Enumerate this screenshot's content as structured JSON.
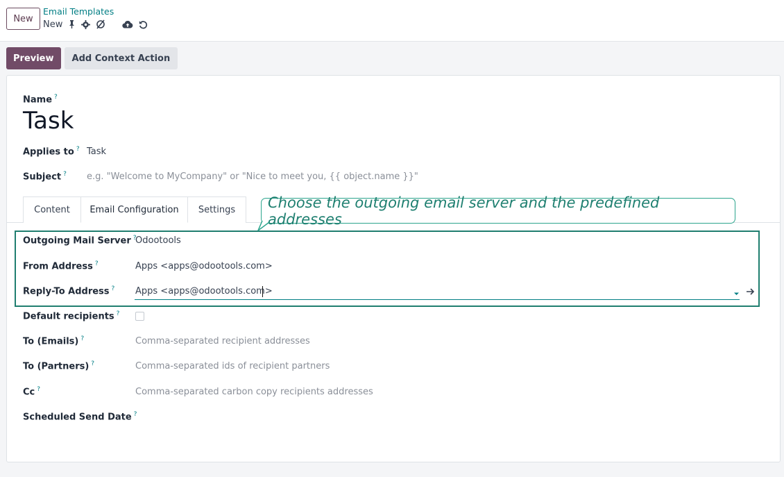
{
  "topbar": {
    "new_label": "New",
    "breadcrumb": "Email Templates",
    "record_label": "New",
    "icons": [
      "pin-icon",
      "gear-icon",
      "refresh-icon",
      "cloud-upload-icon",
      "undo-icon"
    ]
  },
  "actions": {
    "preview": "Preview",
    "add_context": "Add Context Action"
  },
  "form": {
    "name_label": "Name",
    "name_value": "Task",
    "applies_label": "Applies to",
    "applies_value": "Task",
    "subject_label": "Subject",
    "subject_placeholder": "e.g. \"Welcome to MyCompany\" or \"Nice to meet you, {{ object.name }}\"",
    "help_mark": "?"
  },
  "tabs": [
    "Content",
    "Email Configuration",
    "Settings"
  ],
  "callout": "Choose the outgoing email server and the predefined addresses",
  "config": {
    "outgoing_label": "Outgoing Mail Server",
    "outgoing_value": "Odootools",
    "from_label": "From Address",
    "from_value": "Apps <apps@odootools.com>",
    "reply_label": "Reply-To Address",
    "reply_value": "Apps <apps@odootools.com>",
    "default_label": "Default recipients",
    "default_checked": false,
    "to_emails_label": "To (Emails)",
    "to_emails_placeholder": "Comma-separated recipient addresses",
    "to_partners_label": "To (Partners)",
    "to_partners_placeholder": "Comma-separated ids of recipient partners",
    "cc_label": "Cc",
    "cc_placeholder": "Comma-separated carbon copy recipients addresses",
    "scheduled_label": "Scheduled Send Date"
  },
  "colors": {
    "primary": "#714b67",
    "link": "#017e84",
    "callout": "#2ca58d"
  }
}
